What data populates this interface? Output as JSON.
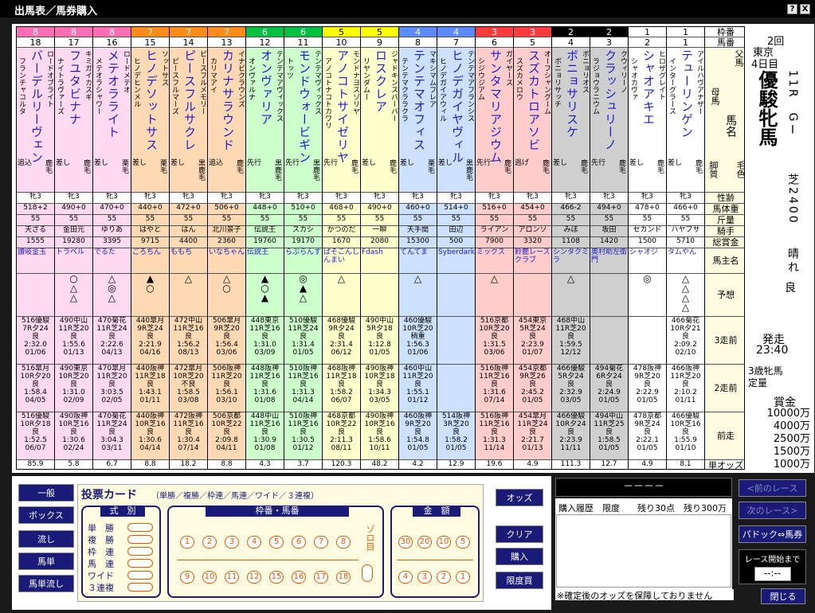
{
  "window": {
    "title": "出馬表／馬券購入",
    "help": "?",
    "close": "X"
  },
  "frame_colors": [
    "#ffffff",
    "#000000",
    "#ff3b3b",
    "#5a8cff",
    "#ffff00",
    "#00c040",
    "#ff8c1a",
    "#ff6eb4"
  ],
  "cell_colors": [
    "#ffffff",
    "#cfcfcf",
    "#ffcccc",
    "#cce0ff",
    "#ffffcc",
    "#ccffcc",
    "#ffd9b3",
    "#ffd9f0"
  ],
  "labels": {
    "waku": "枠番",
    "uma": "馬番",
    "chichi": "父馬",
    "haha": "母馬",
    "bamei": "馬名",
    "kyakushitsu": "脚質",
    "keiro": "毛色",
    "seirei": "性齢",
    "bataiju": "馬体重",
    "kinryo": "斤量",
    "kishu": "騎手",
    "sokin": "総賞金",
    "banushi": "馬主名",
    "yoso": "予想",
    "r3": "3走前",
    "r2": "2走前",
    "r1": "前走",
    "odds": "単オッズ"
  },
  "horses": [
    {
      "waku": 8,
      "uma": "18",
      "name": "バーデルリーヴェン",
      "sire": "ロードオブライト",
      "dam": "フランチャコルタ",
      "style": "追込",
      "coat": "鹿毛",
      "sex": "牝3",
      "weight": "518+2",
      "kin": "55",
      "jockey": "天ざる",
      "prize": "1555",
      "owner": "讃岐釜玉",
      "pred": [
        "",
        "",
        "",
        ""
      ],
      "r3": [
        "516優駿",
        "7R夕24",
        "良",
        "2:32.0",
        "01/06"
      ],
      "r2": [
        "516皐月",
        "10R夕20",
        "良",
        "1:58.4",
        "04/05"
      ],
      "r1": [
        "516優駿",
        "10R夕18",
        "良",
        "1:52.5",
        "06/07"
      ],
      "odds": "85.9"
    },
    {
      "waku": 8,
      "uma": "17",
      "name": "フユタビナナ",
      "sire": "キミガイカスギ",
      "dam": "ナイトラヴァーズ",
      "style": "差し",
      "coat": "鹿毛",
      "sex": "牝3",
      "weight": "490+0",
      "kin": "55",
      "jockey": "金田元",
      "prize": "19280",
      "owner": "トラベル",
      "pred": [
        "○",
        "",
        "△",
        "△"
      ],
      "r3": [
        "490中山",
        "11R芝20",
        "良",
        "1:55.6",
        "01/13"
      ],
      "r2": [
        "490東京",
        "10R芝20",
        "良",
        "1:31.0",
        "02/09"
      ],
      "r1": [
        "490阪神",
        "10R芝16",
        "良",
        "1:30.6",
        "02/24"
      ],
      "odds": "5.8"
    },
    {
      "waku": 8,
      "uma": "16",
      "name": "メテオラライト",
      "sire": "ロードメテオ",
      "dam": "メテオラシャワー",
      "style": "差し",
      "coat": "栗毛",
      "sex": "牝3",
      "weight": "470+0",
      "kin": "55",
      "jockey": "ゆりあ",
      "prize": "3395",
      "owner": "でるた",
      "pred": [
        "△",
        "",
        "◎",
        "△"
      ],
      "r3": [
        "470菊花",
        "11R芝24",
        "良",
        "2:22.6",
        "04/13"
      ],
      "r2": [
        "470皐月",
        "11R芝20",
        "良",
        "3:03.5",
        "02/05"
      ],
      "r1": [
        "470菊花",
        "11R芝24",
        "良",
        "3:04.3",
        "03/11"
      ],
      "odds": "6.7"
    },
    {
      "waku": 7,
      "uma": "15",
      "name": "ヒノデソットサス",
      "sire": "ソットサス",
      "dam": "ヒノデヒンメル",
      "style": "差し",
      "coat": "栗毛",
      "sex": "牝3",
      "weight": "440+0",
      "kin": "55",
      "jockey": "はやと",
      "prize": "9715",
      "owner": "ごろちん",
      "pred": [
        "",
        "▲",
        "○",
        ""
      ],
      "r3": [
        "440皐月",
        "9R芝24",
        "良",
        "2:21.9",
        "04/16"
      ],
      "r2": [
        "440阪神",
        "11R芝18",
        "良",
        "1:43.1",
        "01/11"
      ],
      "r1": [
        "440阪神",
        "10R芝16",
        "良",
        "1:30.6",
        "04/14"
      ],
      "odds": "8.8"
    },
    {
      "waku": 7,
      "uma": "14",
      "name": "ピースフルサクレ",
      "sire": "ピースフルメモリー",
      "dam": "ピースフルマーズ",
      "style": "差し",
      "coat": "黒鹿毛",
      "sex": "牝3",
      "weight": "472+0",
      "kin": "55",
      "jockey": "はん",
      "prize": "4400",
      "owner": "ももち",
      "pred": [
        "△",
        "",
        "",
        ""
      ],
      "r3": [
        "472中山",
        "11R芝16",
        "良",
        "1:56.2",
        "08/13"
      ],
      "r2": [
        "472皐月",
        "10R芝20",
        "不良",
        "1:58.5",
        "03/08"
      ],
      "r1": [
        "472阪神",
        "11R芝16",
        "良",
        "1:30.4",
        "07/14"
      ],
      "odds": "18.2"
    },
    {
      "waku": 7,
      "uma": "13",
      "name": "カリナサラウンド",
      "sire": "イナビクラウンズ",
      "dam": "カリマアイ",
      "style": "追込",
      "coat": "鹿毛",
      "sex": "牝3",
      "weight": "506+0",
      "kin": "55",
      "jockey": "北川景子",
      "prize": "2360",
      "owner": "いなちゃん",
      "pred": [
        "△",
        "",
        "○",
        ""
      ],
      "r3": [
        "506皐月",
        "9R芝20",
        "良",
        "1:56.4",
        "03/06"
      ],
      "r2": [
        "506阪神",
        "11R芝20",
        "良",
        "1:56.1",
        "03/10"
      ],
      "r1": [
        "506京都",
        "10R芝22",
        "良",
        "2:09.8",
        "04/11"
      ],
      "odds": "8.8"
    },
    {
      "waku": 6,
      "uma": "12",
      "name": "オンヴァリア",
      "sire": "テンテマアヴィックス",
      "dam": "オンヴァルナ",
      "style": "先行",
      "coat": "黒鹿毛",
      "sex": "牝3",
      "weight": "448+0",
      "kin": "55",
      "jockey": "伝説王",
      "prize": "19760",
      "owner": "伝説王",
      "pred": [
        "▲",
        "",
        "○",
        "▲"
      ],
      "r3": [
        "448東京",
        "11R芝16",
        "良",
        "1:31.0",
        "03/09"
      ],
      "r2": [
        "448阪神",
        "11R芝16",
        "良",
        "1:31.6",
        "01/08"
      ],
      "r1": [
        "448中山",
        "11R芝16",
        "良",
        "1:30.9",
        "01/08"
      ],
      "odds": "4.3"
    },
    {
      "waku": 6,
      "uma": "11",
      "name": "モンドウォービギン",
      "sire": "テンテマヴィックス",
      "dam": "トッツ",
      "style": "先行",
      "coat": "黒鹿毛",
      "sex": "牝3",
      "weight": "510+0",
      "kin": "55",
      "jockey": "スカシ",
      "prize": "19170",
      "owner": "らぷらんす",
      "pred": [
        "◎",
        "",
        "▲",
        "△"
      ],
      "r3": [
        "510優駿",
        "11R芝24",
        "良",
        "1:31.4",
        "01/05"
      ],
      "r2": [
        "510阪神",
        "11R芝16",
        "良",
        "1:31.3",
        "04/14"
      ],
      "r1": [
        "510阪神",
        "11R芝16",
        "良",
        "1:30.5",
        "01/12"
      ],
      "odds": "3.7"
    },
    {
      "waku": 5,
      "uma": "10",
      "name": "アノコトサイゼリヤ",
      "sire": "モンドナヨスゾリヤ",
      "dam": "アノコトナコトカワリ",
      "style": "先行",
      "coat": "鹿毛",
      "sex": "牝3",
      "weight": "468+0",
      "kin": "55",
      "jockey": "かつのだ",
      "prize": "1670",
      "owner": "ぱそこんしんまい",
      "pred": [
        "△",
        "",
        "",
        ""
      ],
      "r3": [
        "468優駿",
        "9R夕24",
        "良",
        "2:31.4",
        "06/12"
      ],
      "r2": [
        "468阪神",
        "11R芝18",
        "良",
        "1:58.2",
        "06/07"
      ],
      "r1": [
        "468京都",
        "10R芝22",
        "良",
        "2:11.3",
        "08/11"
      ],
      "odds": "120.3"
    },
    {
      "waku": 5,
      "uma": "9",
      "name": "ロスクレア",
      "sire": "ジャドキンスバーバー",
      "dam": "リヤンダムー",
      "style": "差し",
      "coat": "鹿毛",
      "sex": "牝3",
      "weight": "490+0",
      "kin": "55",
      "jockey": "一瞬",
      "prize": "2080",
      "owner": "Fdash",
      "pred": [
        "",
        "",
        "",
        ""
      ],
      "r3": [
        "490中山",
        "5R夕18",
        "良",
        "1:12.8",
        "01/05"
      ],
      "r2": [
        "490阪神",
        "10R芝18",
        "良",
        "1:34.3",
        "03/05"
      ],
      "r1": [
        "490阪神",
        "10R芝16",
        "良",
        "1:58.6",
        "10/11"
      ],
      "odds": "48.2"
    },
    {
      "waku": 4,
      "uma": "8",
      "name": "テンテマオフィス",
      "sire": "マキシマムフレア",
      "dam": "テンテマクララクラ",
      "style": "差し",
      "coat": "栗毛",
      "sex": "牝3",
      "weight": "460+0",
      "kin": "55",
      "jockey": "天手間",
      "prize": "15300",
      "owner": "てんてま",
      "pred": [
        "△",
        "",
        "",
        ""
      ],
      "r3": [
        "460優駿",
        "10R芝20",
        "稍重",
        "1:56.3",
        "01/06"
      ],
      "r2": [
        "460中山",
        "11R芝20",
        "良",
        "1:55.1",
        "01/12"
      ],
      "r1": [
        "460阪神",
        "9R芝20",
        "良",
        "1:54.8",
        "01/05"
      ],
      "odds": "4.2"
    },
    {
      "waku": 4,
      "uma": "7",
      "name": "ヒノデガイヤヴィル",
      "sire": "テンテマアフランシス",
      "dam": "ヒノデガイアウィル",
      "style": "差し",
      "coat": "黒鹿毛",
      "sex": "牝3",
      "weight": "514+0",
      "kin": "55",
      "jockey": "田辺",
      "prize": "500",
      "owner": "Syberdark",
      "pred": [
        "",
        "",
        "",
        ""
      ],
      "r3": [
        "",
        "",
        "",
        "",
        ""
      ],
      "r2": [
        "",
        "",
        "",
        "",
        ""
      ],
      "r1": [
        "514阪神",
        "3R芝20",
        "良",
        "1:58.2",
        "01/05"
      ],
      "odds": "12.9"
    },
    {
      "waku": 3,
      "uma": "6",
      "name": "サンタマリアジウム",
      "sire": "ガイヤース",
      "dam": "シジウジアム",
      "style": "先行",
      "coat": "鹿毛",
      "sex": "牝3",
      "weight": "516+0",
      "kin": "55",
      "jockey": "ライアン",
      "prize": "7900",
      "owner": "ミックス",
      "pred": [
        "△",
        "",
        "",
        ""
      ],
      "r3": [
        "516京都",
        "10R芝20",
        "良",
        "1:31.5",
        "03/06"
      ],
      "r2": [
        "516阪神",
        "11R芝16",
        "良",
        "1:31.6",
        "07/14"
      ],
      "r1": [
        "516阪神",
        "11R芝16",
        "良",
        "1:31.3",
        "11/14"
      ],
      "odds": "19.6"
    },
    {
      "waku": 3,
      "uma": "5",
      "name": "スズカトロアソビ",
      "sire": "オーフシャングーム",
      "dam": "スズカメロウ",
      "style": "逃げ",
      "coat": "鹿毛",
      "sex": "牝3",
      "weight": "454+0",
      "kin": "55",
      "jockey": "アロンソ",
      "prize": "3320",
      "owner": "鈴鹿レースクラブ",
      "pred": [
        "",
        "",
        "",
        ""
      ],
      "r3": [
        "454東京",
        "5R芝24",
        "良",
        "2:23.9",
        "01/07"
      ],
      "r2": [
        "454京都",
        "9R芝26",
        "良",
        "2:45.2",
        "01/05"
      ],
      "r1": [
        "454皐月",
        "11R芝24",
        "良",
        "2:21.7",
        "01/13"
      ],
      "odds": "4.9"
    },
    {
      "waku": 2,
      "uma": "4",
      "name": "ボニョサリスケ",
      "sire": "ボニョリオス",
      "dam": "ボニョリサッチ",
      "style": "差し",
      "coat": "鹿毛",
      "sex": "牝3",
      "weight": "466-2",
      "kin": "55",
      "jockey": "みほ",
      "prize": "1108",
      "owner": "シンタクミラ",
      "pred": [
        "△",
        "",
        "",
        ""
      ],
      "r3": [
        "468中山",
        "11R芝20",
        "良",
        "1:59.5",
        "12/12"
      ],
      "r2": [
        "466優駿",
        "5R夕24",
        "良",
        "2:32.9",
        "03/05"
      ],
      "r1": [
        "466優駿",
        "10R夕24",
        "良",
        "2:23.9",
        "11/11"
      ],
      "odds": "111.3"
    },
    {
      "waku": 2,
      "uma": "3",
      "name": "クラッシュリーノ",
      "sire": "クウィリーノ",
      "dam": "ラジョウラニウム",
      "style": "先行",
      "coat": "鹿毛",
      "sex": "牝3",
      "weight": "494+0",
      "kin": "55",
      "jockey": "坂田",
      "prize": "1420",
      "owner": "奥村助左衛門",
      "pred": [
        "",
        "",
        "",
        ""
      ],
      "r3": [
        "",
        "",
        "",
        "",
        ""
      ],
      "r2": [
        "494菊花",
        "6R夕24",
        "良",
        "2:24.9",
        "01/05"
      ],
      "r1": [
        "494中山",
        "11R芝25",
        "良",
        "1:58.5",
        "01/05"
      ],
      "odds": "12.7"
    },
    {
      "waku": 1,
      "uma": "2",
      "name": "シャオアキエ",
      "sire": "ヒロザグレイト",
      "dam": "シャオカヴァ",
      "style": "差し",
      "coat": "鹿毛",
      "sex": "牝3",
      "weight": "478+0",
      "kin": "55",
      "jockey": "セカンド",
      "prize": "1500",
      "owner": "シャオジ",
      "pred": [
        "◎",
        "",
        "",
        ""
      ],
      "r3": [
        "",
        "",
        "",
        "",
        ""
      ],
      "r2": [
        "478阪神",
        "9R芝20",
        "良",
        "2:22.9",
        "01/05"
      ],
      "r1": [
        "478京都",
        "9R芝24",
        "良",
        "2:22.1",
        "01/05"
      ],
      "odds": "4.9"
    },
    {
      "waku": 1,
      "uma": "1",
      "name": "テューリンゲン",
      "sire": "アイルハヴアナザー",
      "dam": "インターグラース",
      "style": "差し",
      "coat": "鹿毛",
      "sex": "牝3",
      "weight": "466+0",
      "kin": "55",
      "jockey": "ハヤブサ",
      "prize": "5710",
      "owner": "タムやん",
      "pred": [
        "△",
        "△",
        "△",
        "△"
      ],
      "r3": [
        "466菊花",
        "10R夕21",
        "良",
        "2:09.2",
        "02/10"
      ],
      "r2": [
        "466阪神",
        "11R芝20",
        "良",
        "2:10.2",
        "01/11"
      ],
      "r1": [
        "466優駿",
        "10R芝16",
        "良",
        "1:55.9",
        "01/10"
      ],
      "odds": "8.1"
    }
  ],
  "race": {
    "kai": "2回",
    "place": "東京",
    "day": "4日目",
    "num": "11R",
    "grade": "GⅠ",
    "name": "優駿牝馬",
    "course": "芝2400",
    "weather": "晴れ",
    "track": "良",
    "start_label": "発走",
    "start_time": "23:40",
    "cond1": "3歳牝馬",
    "cond2": "定量",
    "prize_label": "賞金",
    "prizes": [
      "10000万",
      "4000万",
      "2500万",
      "1500万",
      "1000万"
    ]
  },
  "sidebar": {
    "ippan": "一般",
    "box": "ボックス",
    "nagashi": "流し",
    "umatan": "馬単",
    "umatan_nagashi": "馬単流し"
  },
  "ticket": {
    "title": "投票カード",
    "subtitle": "（単勝／複勝／枠連／馬連／ワイド／３連複）",
    "shiki": "式　別",
    "types": [
      "単　勝",
      "複　勝",
      "枠　連",
      "馬　連",
      "ワイド",
      "３連複"
    ],
    "waku_uma": "枠番・馬番",
    "row1": [
      "1",
      "2",
      "3",
      "4",
      "5",
      "6",
      "7",
      "8"
    ],
    "row2": [
      "9",
      "10",
      "11",
      "12",
      "15",
      "16",
      "17",
      "18"
    ],
    "zoro": "ゾロ目",
    "kingaku": "金　額",
    "amt1": [
      "30",
      "20",
      "10",
      "5"
    ],
    "amt2": [
      "4",
      "3",
      "2",
      "1"
    ]
  },
  "actions": {
    "odds": "オッズ",
    "clear": "クリア",
    "buy": "購入",
    "limit": "限度買"
  },
  "history": {
    "header": "－－－－",
    "label": "購入履歴　限度　　残り30点　残り300万",
    "note": "※確定後のオッズを保障しておりません"
  },
  "nav": {
    "prev": "<前のレース",
    "next": "次のレース>",
    "paddock": "パドック⇔馬券",
    "countdown_label": "レース開始まで",
    "countdown": "--:--",
    "close": "閉じる"
  }
}
